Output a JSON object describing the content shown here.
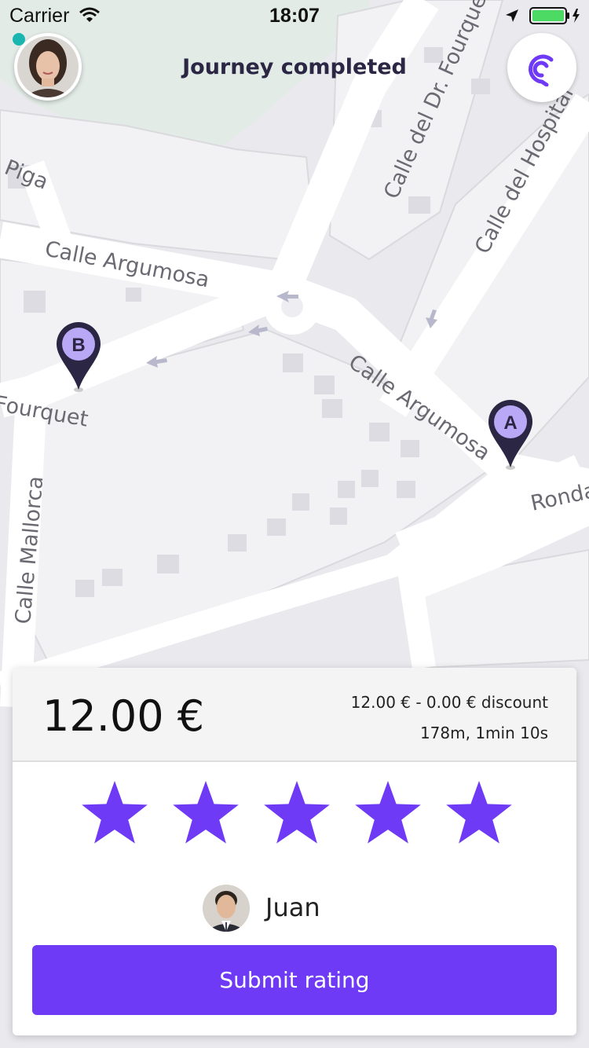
{
  "status_bar": {
    "carrier": "Carrier",
    "time": "18:07"
  },
  "header": {
    "title": "Journey completed",
    "online_color": "#1ab5b0",
    "logo_icon": "cabify-logo-icon"
  },
  "map": {
    "street_labels": {
      "piga": "Piga",
      "argumosa_top": "Calle Argumosa",
      "dr_fourquet": "Calle del Dr. Fourquet",
      "hospital": "Calle del Hospital",
      "argumosa_bottom": "Calle Argumosa",
      "fourquet_left": "Fourquet",
      "mallorca": "Calle Mallorca",
      "ronda": "Ronda"
    },
    "markers": {
      "start": "A",
      "end": "B"
    }
  },
  "card": {
    "price": "12.00 €",
    "fare_breakdown": "12.00 € - 0.00 € discount",
    "trip_stats": "178m, 1min 10s",
    "rating": {
      "max": 5,
      "selected": 5,
      "star_color": "#6e3af5"
    },
    "driver_name": "Juan",
    "submit_label": "Submit rating",
    "accent_color": "#6e3af5"
  }
}
